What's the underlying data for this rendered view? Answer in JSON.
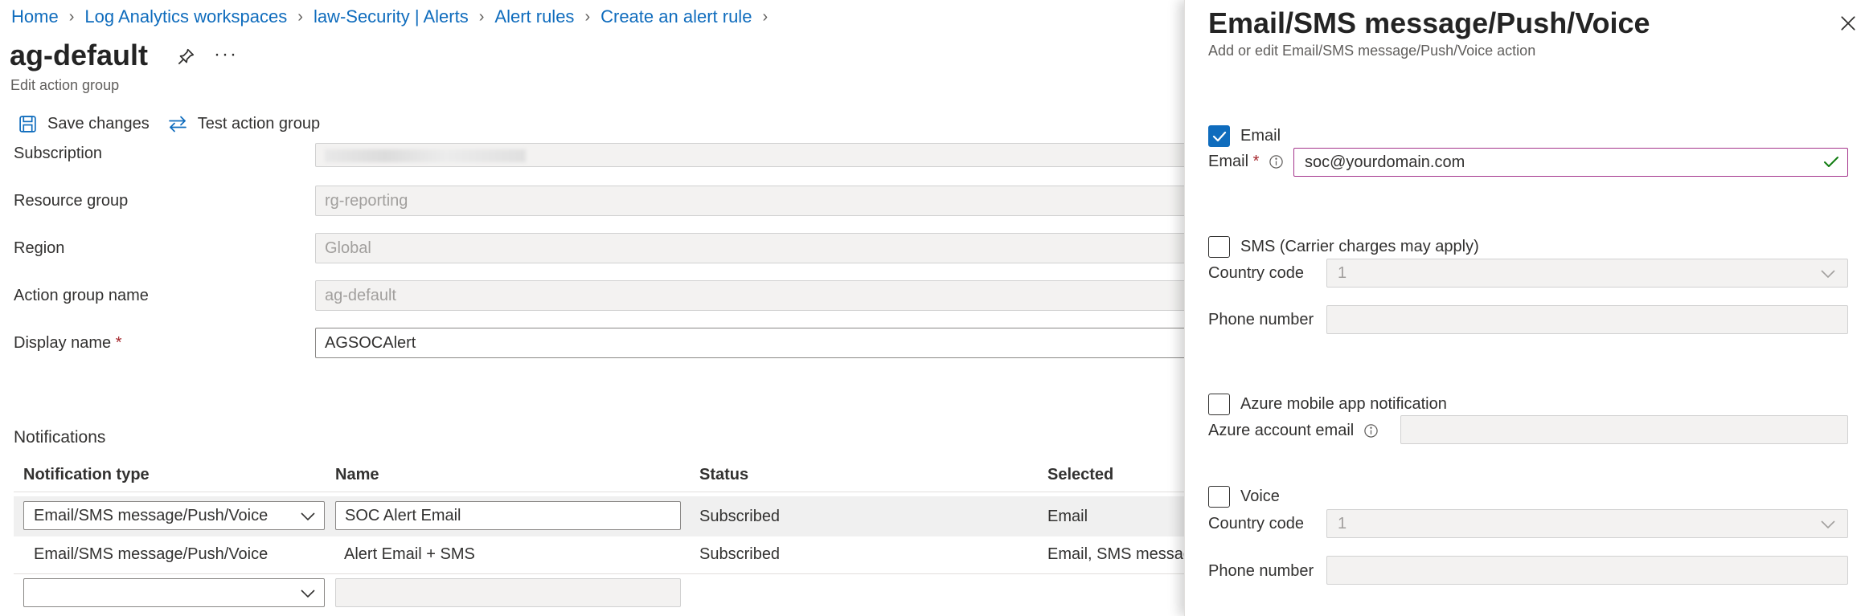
{
  "breadcrumb": [
    {
      "label": "Home"
    },
    {
      "label": "Log Analytics workspaces"
    },
    {
      "label": "law-Security | Alerts"
    },
    {
      "label": "Alert rules"
    },
    {
      "label": "Create an alert rule"
    }
  ],
  "page": {
    "title": "ag-default",
    "subtitle": "Edit action group"
  },
  "toolbar": {
    "save_label": "Save changes",
    "test_label": "Test action group"
  },
  "form": {
    "subscription_label": "Subscription",
    "resource_group_label": "Resource group",
    "resource_group_value": "rg-reporting",
    "region_label": "Region",
    "region_value": "Global",
    "action_group_name_label": "Action group name",
    "action_group_name_value": "ag-default",
    "display_name_label": "Display name",
    "display_name_value": "AGSOCAlert",
    "required_marker": "*"
  },
  "notifications": {
    "title": "Notifications",
    "columns": {
      "type": "Notification type",
      "name": "Name",
      "status": "Status",
      "selected": "Selected"
    },
    "rows": [
      {
        "type": "Email/SMS message/Push/Voice",
        "name": "SOC Alert Email",
        "status": "Subscribed",
        "selected": "Email"
      },
      {
        "type": "Email/SMS message/Push/Voice",
        "name": "Alert Email + SMS",
        "status": "Subscribed",
        "selected": "Email, SMS message"
      }
    ]
  },
  "panel": {
    "title": "Email/SMS message/Push/Voice",
    "subtitle": "Add or edit Email/SMS message/Push/Voice action",
    "email": {
      "checkbox_label": "Email",
      "checked": true,
      "field_label": "Email",
      "value": "soc@yourdomain.com"
    },
    "sms": {
      "checkbox_label": "SMS (Carrier charges may apply)",
      "checked": false,
      "country_code_label": "Country code",
      "country_code_value": "1",
      "phone_label": "Phone number"
    },
    "push": {
      "checkbox_label": "Azure mobile app notification",
      "checked": false,
      "account_email_label": "Azure account email"
    },
    "voice": {
      "checkbox_label": "Voice",
      "checked": false,
      "country_code_label": "Country code",
      "country_code_value": "1",
      "phone_label": "Phone number"
    }
  },
  "colors": {
    "link": "#0f6cbd",
    "checkbox_checked": "#0f6cbd",
    "required": "#a4262c",
    "valid_check": "#107c10",
    "active_border": "#a4358c"
  }
}
